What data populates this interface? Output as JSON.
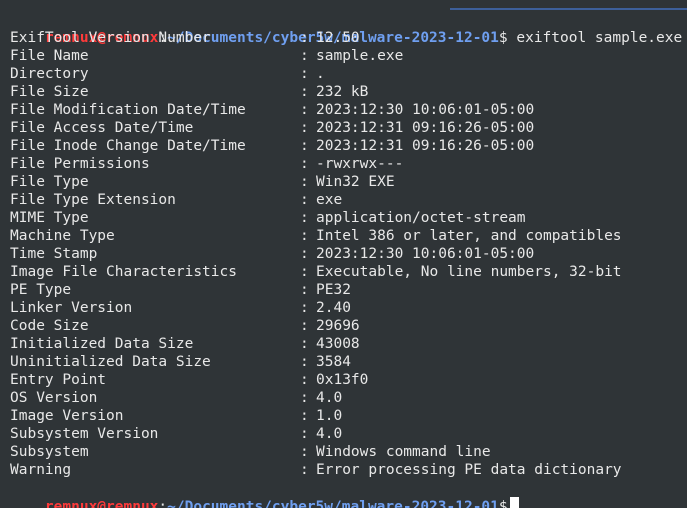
{
  "prompt": {
    "user_host": "remnux@remnux",
    "sep": ":",
    "path": "~/Documents/cyber5w/malware-2023-12-01",
    "dollar": "$",
    "command": " exiftool sample.exe"
  },
  "rows": [
    {
      "key": "ExifTool Version Number",
      "value": "12.50"
    },
    {
      "key": "File Name",
      "value": "sample.exe"
    },
    {
      "key": "Directory",
      "value": "."
    },
    {
      "key": "File Size",
      "value": "232 kB"
    },
    {
      "key": "File Modification Date/Time",
      "value": "2023:12:30 10:06:01-05:00"
    },
    {
      "key": "File Access Date/Time",
      "value": "2023:12:31 09:16:26-05:00"
    },
    {
      "key": "File Inode Change Date/Time",
      "value": "2023:12:31 09:16:26-05:00"
    },
    {
      "key": "File Permissions",
      "value": "-rwxrwx---"
    },
    {
      "key": "File Type",
      "value": "Win32 EXE"
    },
    {
      "key": "File Type Extension",
      "value": "exe"
    },
    {
      "key": "MIME Type",
      "value": "application/octet-stream"
    },
    {
      "key": "Machine Type",
      "value": "Intel 386 or later, and compatibles"
    },
    {
      "key": "Time Stamp",
      "value": "2023:12:30 10:06:01-05:00"
    },
    {
      "key": "Image File Characteristics",
      "value": "Executable, No line numbers, 32-bit"
    },
    {
      "key": "PE Type",
      "value": "PE32"
    },
    {
      "key": "Linker Version",
      "value": "2.40"
    },
    {
      "key": "Code Size",
      "value": "29696"
    },
    {
      "key": "Initialized Data Size",
      "value": "43008"
    },
    {
      "key": "Uninitialized Data Size",
      "value": "3584"
    },
    {
      "key": "Entry Point",
      "value": "0x13f0"
    },
    {
      "key": "OS Version",
      "value": "4.0"
    },
    {
      "key": "Image Version",
      "value": "1.0"
    },
    {
      "key": "Subsystem Version",
      "value": "4.0"
    },
    {
      "key": "Subsystem",
      "value": "Windows command line"
    },
    {
      "key": "Warning",
      "value": "Error processing PE data dictionary"
    }
  ],
  "colon": ":",
  "colors": {
    "background": "#2f3437",
    "prompt_user": "#ff3a3a",
    "prompt_path": "#6f9ff0",
    "text": "#e8e8e8",
    "cursor": "#ffffff"
  }
}
